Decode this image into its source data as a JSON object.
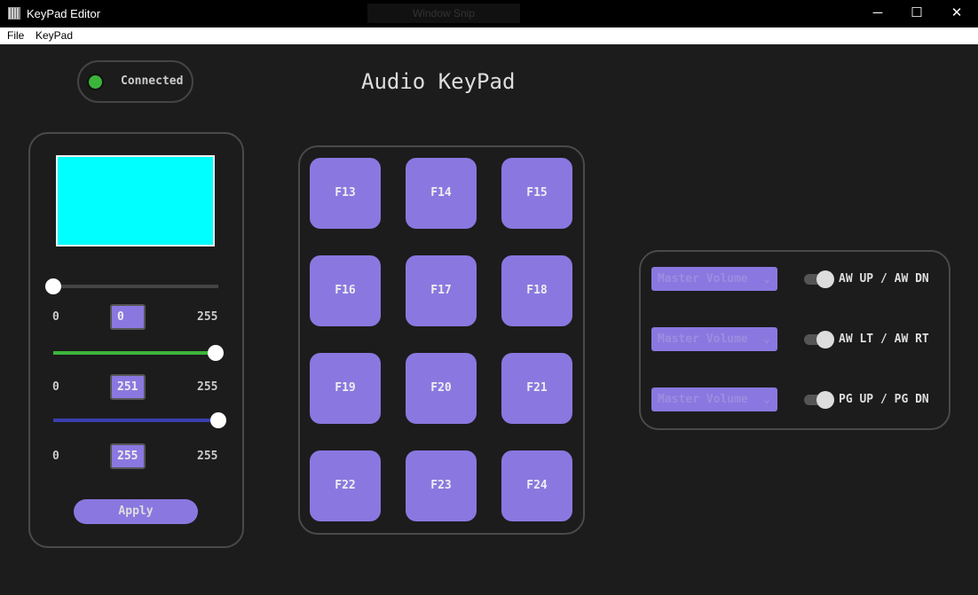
{
  "window": {
    "title": "KeyPad Editor",
    "overlay": "Window Snip",
    "minimize": "─",
    "maximize": "☐",
    "close": "✕"
  },
  "menu": [
    "File",
    "KeyPad"
  ],
  "status": {
    "label": "Connected",
    "color": "#3cb43c"
  },
  "page_title": "Audio KeyPad",
  "color": {
    "preview": "#00ffff",
    "apply": "Apply",
    "sliders": [
      {
        "channel": "red",
        "min": "0",
        "max": "255",
        "value": "0",
        "fraction": 0,
        "color": "#d03030"
      },
      {
        "channel": "green",
        "min": "0",
        "max": "255",
        "value": "251",
        "fraction": 0.984,
        "color": "#3cb43c"
      },
      {
        "channel": "blue",
        "min": "0",
        "max": "255",
        "value": "255",
        "fraction": 1,
        "color": "#3a3fb0"
      }
    ]
  },
  "keys": [
    "F13",
    "F14",
    "F15",
    "F16",
    "F17",
    "F18",
    "F19",
    "F20",
    "F21",
    "F22",
    "F23",
    "F24"
  ],
  "encoders": [
    {
      "select": "Master Volume",
      "label": "AW UP / AW DN"
    },
    {
      "select": "Master Volume",
      "label": "AW LT / AW RT"
    },
    {
      "select": "Master Volume",
      "label": "PG UP / PG DN"
    }
  ],
  "accent": "#8a78e0"
}
